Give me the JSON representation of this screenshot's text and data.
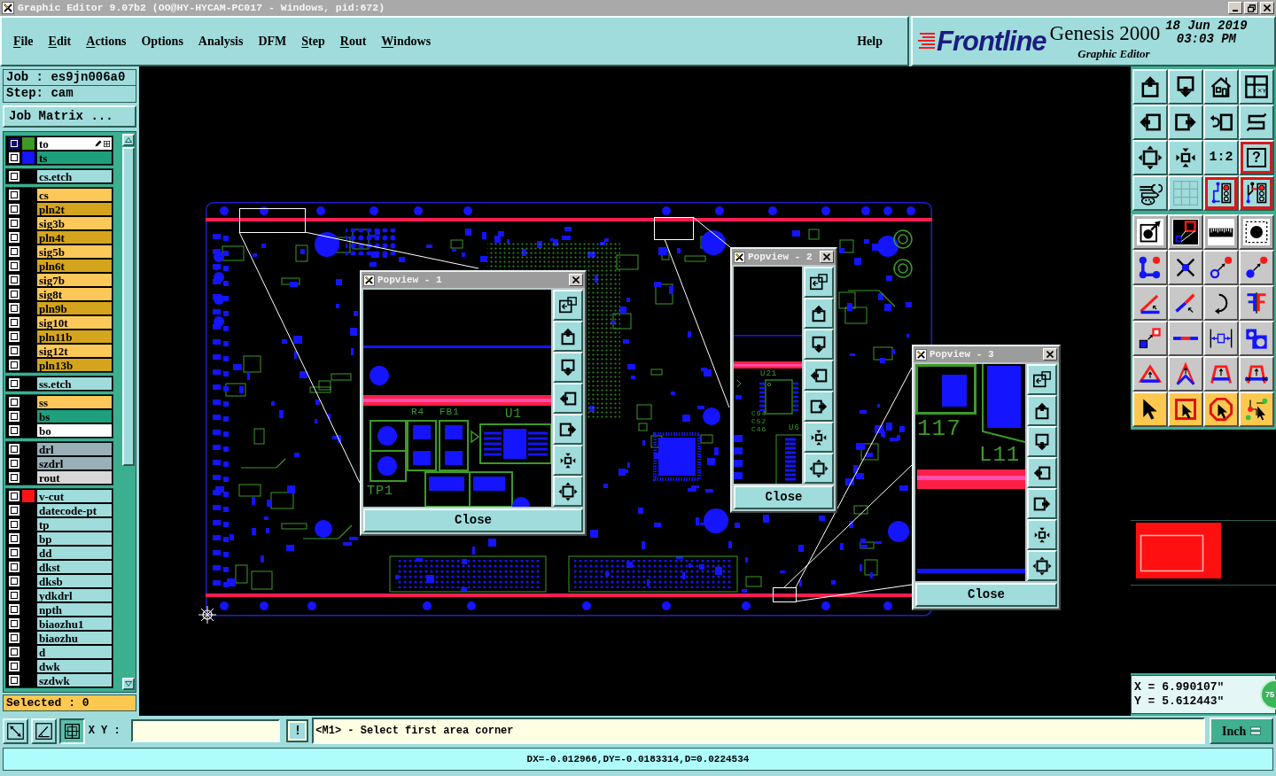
{
  "window": {
    "title": "Graphic Editor 9.07b2 (OO@HY-HYCAM-PC017 - Windows, pid:672)"
  },
  "menu": [
    {
      "label": "File",
      "underlined": true
    },
    {
      "label": "Edit",
      "underlined": true
    },
    {
      "label": "Actions",
      "underlined": true
    },
    {
      "label": "Options",
      "underlined": false
    },
    {
      "label": "Analysis",
      "underlined": false
    },
    {
      "label": "DFM",
      "underlined": false
    },
    {
      "label": "Step",
      "underlined": true
    },
    {
      "label": "Rout",
      "underlined": true
    },
    {
      "label": "Windows",
      "underlined": true
    }
  ],
  "help_menu": {
    "label": "Help",
    "underlined": false
  },
  "branding": {
    "logo": "Frontline",
    "product": "Genesis 2000",
    "module": "Graphic Editor",
    "date": "18 Jun 2019",
    "time": "03:03 PM"
  },
  "job": {
    "job_label": "Job : es9jn006a0",
    "step_label": "Step: cam",
    "matrix_button": "Job Matrix ..."
  },
  "layer_groups": [
    {
      "layers": [
        {
          "name": "to",
          "kind": "silk",
          "color": "#3c9a28",
          "selected": true
        },
        {
          "name": "ts",
          "kind": "mask",
          "color": "#1414ff",
          "selected": false
        }
      ]
    },
    {
      "layers": [
        {
          "name": "cs.etch",
          "kind": "misc",
          "selected": false
        }
      ]
    },
    {
      "layers": [
        {
          "name": "cs",
          "kind": "signal",
          "selected": false
        },
        {
          "name": "pln2t",
          "kind": "plane",
          "selected": false
        },
        {
          "name": "sig3b",
          "kind": "signal",
          "selected": false
        },
        {
          "name": "pln4t",
          "kind": "plane",
          "selected": false
        },
        {
          "name": "sig5b",
          "kind": "signal",
          "selected": false
        },
        {
          "name": "pln6t",
          "kind": "plane",
          "selected": false
        },
        {
          "name": "sig7b",
          "kind": "signal",
          "selected": false
        },
        {
          "name": "sig8t",
          "kind": "signal",
          "selected": false
        },
        {
          "name": "pln9b",
          "kind": "plane",
          "selected": false
        },
        {
          "name": "sig10t",
          "kind": "signal",
          "selected": false
        },
        {
          "name": "pln11b",
          "kind": "plane",
          "selected": false
        },
        {
          "name": "sig12t",
          "kind": "signal",
          "selected": false
        },
        {
          "name": "pln13b",
          "kind": "plane",
          "selected": false
        }
      ]
    },
    {
      "layers": [
        {
          "name": "ss.etch",
          "kind": "misc",
          "selected": false
        }
      ]
    },
    {
      "layers": [
        {
          "name": "ss",
          "kind": "signal",
          "selected": false
        },
        {
          "name": "bs",
          "kind": "mask",
          "selected": false
        },
        {
          "name": "bo",
          "kind": "silk",
          "selected": false
        }
      ]
    },
    {
      "layers": [
        {
          "name": "drl",
          "kind": "drill",
          "selected": false
        },
        {
          "name": "szdrl",
          "kind": "drill",
          "selected": false
        },
        {
          "name": "rout",
          "kind": "rout",
          "selected": false
        }
      ]
    },
    {
      "layers": [
        {
          "name": "v-cut",
          "kind": "misc",
          "color": "#ff1414",
          "selected": false
        },
        {
          "name": "datecode-pt",
          "kind": "misc",
          "selected": false
        },
        {
          "name": "tp",
          "kind": "misc",
          "selected": false
        },
        {
          "name": "bp",
          "kind": "misc",
          "selected": false
        },
        {
          "name": "dd",
          "kind": "misc",
          "selected": false
        },
        {
          "name": "dkst",
          "kind": "misc",
          "selected": false
        },
        {
          "name": "dksb",
          "kind": "misc",
          "selected": false
        },
        {
          "name": "ydkdrl",
          "kind": "misc",
          "selected": false
        },
        {
          "name": "npth",
          "kind": "misc",
          "selected": false
        },
        {
          "name": "biaozhu1",
          "kind": "misc",
          "selected": false
        },
        {
          "name": "biaozhu",
          "kind": "misc",
          "selected": false
        },
        {
          "name": "d",
          "kind": "misc",
          "selected": false
        },
        {
          "name": "dwk",
          "kind": "misc",
          "selected": false
        },
        {
          "name": "szdwk",
          "kind": "misc",
          "selected": false
        }
      ]
    }
  ],
  "selection_count": "Selected : 0",
  "popviews": [
    {
      "title": "Popview - 1",
      "close_button": "Close",
      "labels": [
        "R4",
        "FB1",
        "U1",
        "TP1"
      ]
    },
    {
      "title": "Popview - 2",
      "close_button": "Close",
      "labels": [
        "U21",
        "C64",
        "C52",
        "C46",
        "U6"
      ]
    },
    {
      "title": "Popview - 3",
      "close_button": "Close",
      "labels": [
        "117",
        "L11"
      ]
    }
  ],
  "tools": [
    {
      "kind": "view",
      "on": false
    },
    {
      "kind": "view",
      "on": false
    },
    {
      "kind": "view",
      "on": false
    },
    {
      "kind": "view",
      "on": false
    },
    {
      "kind": "view",
      "on": false
    },
    {
      "kind": "view",
      "on": false
    },
    {
      "kind": "view",
      "on": false
    },
    {
      "kind": "view",
      "on": false
    },
    {
      "kind": "view",
      "on": false
    },
    {
      "kind": "view",
      "on": false
    },
    {
      "kind": "view",
      "on": false,
      "label": "1:2"
    },
    {
      "kind": "view",
      "on": true,
      "label": "?"
    },
    {
      "kind": "view",
      "on": false
    },
    {
      "kind": "view",
      "on": false
    },
    {
      "kind": "view",
      "on": true
    },
    {
      "kind": "view",
      "on": true
    },
    {
      "kind": "snap",
      "on": false
    },
    {
      "kind": "snap",
      "on": false
    },
    {
      "kind": "snap",
      "on": false
    },
    {
      "kind": "snap",
      "on": false
    },
    {
      "kind": "edit",
      "on": false
    },
    {
      "kind": "edit",
      "on": false
    },
    {
      "kind": "edit",
      "on": false
    },
    {
      "kind": "edit",
      "on": false
    },
    {
      "kind": "edit",
      "on": false
    },
    {
      "kind": "edit",
      "on": false
    },
    {
      "kind": "edit",
      "on": false
    },
    {
      "kind": "edit",
      "on": false
    },
    {
      "kind": "edit",
      "on": false
    },
    {
      "kind": "edit",
      "on": false
    },
    {
      "kind": "edit",
      "on": false
    },
    {
      "kind": "edit",
      "on": false
    },
    {
      "kind": "edit",
      "on": false
    },
    {
      "kind": "edit",
      "on": false
    },
    {
      "kind": "edit",
      "on": false
    },
    {
      "kind": "edit",
      "on": false
    },
    {
      "kind": "select",
      "on": false
    },
    {
      "kind": "select",
      "on": false
    },
    {
      "kind": "select",
      "on": false
    },
    {
      "kind": "select",
      "on": false
    }
  ],
  "coordinates": {
    "x": "X = 6.990107\"",
    "y": "Y = 5.612443\"",
    "badge": "75"
  },
  "command_bar": {
    "snap_modes": [
      {
        "on": false
      },
      {
        "on": false
      },
      {
        "on": true
      }
    ],
    "xy_label": "X Y :",
    "alert_button": "!",
    "message": "<M1> - Select first area corner",
    "units": "Inch"
  },
  "status_bar": {
    "text": "DX=-0.012966,DY=-0.0183314,D=0.0224534"
  }
}
